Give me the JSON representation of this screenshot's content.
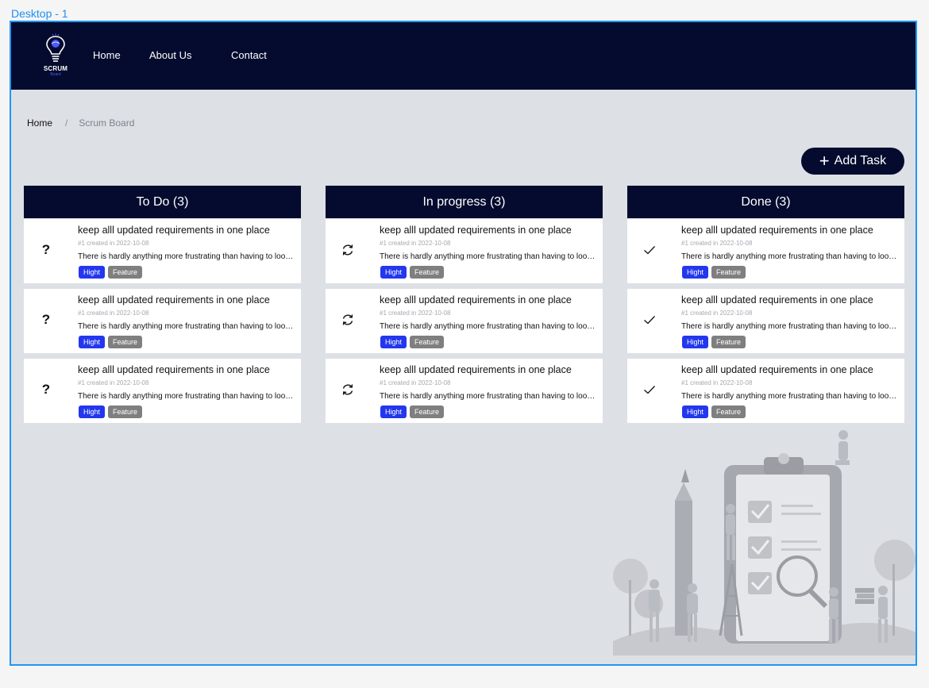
{
  "frame": {
    "label": "Desktop - 1"
  },
  "logo": {
    "text": "SCRUM",
    "subtext": "Board"
  },
  "nav": {
    "home": "Home",
    "about": "About Us",
    "contact": "Contact"
  },
  "breadcrumb": {
    "home": "Home",
    "separator": "/",
    "current": "Scrum Board"
  },
  "add_task": {
    "plus": "+",
    "label": "Add Task"
  },
  "columns": [
    {
      "title": "To Do (3)",
      "icon": "question-mark-icon",
      "cards": [
        {
          "title": "keep alll updated requirements in one place",
          "meta": "#1 created in 2022-10-08",
          "desc": "There is hardly anything more frustrating than having to look for current requirements in tens of comments",
          "priority": "Hight",
          "type": "Feature"
        },
        {
          "title": "keep alll updated requirements in one place",
          "meta": "#1 created in 2022-10-08",
          "desc": "There is hardly anything more frustrating than having to look for current requirements in tens of comments",
          "priority": "Hight",
          "type": "Feature"
        },
        {
          "title": "keep alll updated requirements in one place",
          "meta": "#1 created in 2022-10-08",
          "desc": "There is hardly anything more frustrating than having to look for current requirements in tens of comments",
          "priority": "Hight",
          "type": "Feature"
        }
      ]
    },
    {
      "title": "In progress (3)",
      "icon": "refresh-icon",
      "cards": [
        {
          "title": "keep alll updated requirements in one place",
          "meta": "#1 created in 2022-10-08",
          "desc": "There is hardly anything more frustrating than having to look for current requirements in tens of comments",
          "priority": "Hight",
          "type": "Feature"
        },
        {
          "title": "keep alll updated requirements in one place",
          "meta": "#1 created in 2022-10-08",
          "desc": "There is hardly anything more frustrating than having to look for current requirements in tens of comments",
          "priority": "Hight",
          "type": "Feature"
        },
        {
          "title": "keep alll updated requirements in one place",
          "meta": "#1 created in 2022-10-08",
          "desc": "There is hardly anything more frustrating than having to look for current requirements in tens of comments",
          "priority": "Hight",
          "type": "Feature"
        }
      ]
    },
    {
      "title": "Done (3)",
      "icon": "checkmark-icon",
      "cards": [
        {
          "title": "keep alll updated requirements in one place",
          "meta": "#1 created in 2022-10-08",
          "desc": "There is hardly anything more frustrating than having to look for current requirements in tens of comments",
          "priority": "Hight",
          "type": "Feature"
        },
        {
          "title": "keep alll updated requirements in one place",
          "meta": "#1 created in 2022-10-08",
          "desc": "There is hardly anything more frustrating than having to look for current requirements in tens of comments",
          "priority": "Hight",
          "type": "Feature"
        },
        {
          "title": "keep alll updated requirements in one place",
          "meta": "#1 created in 2022-10-08",
          "desc": "There is hardly anything more frustrating than having to look for current requirements in tens of comments",
          "priority": "Hight",
          "type": "Feature"
        }
      ]
    }
  ],
  "colors": {
    "navy": "#040b2e",
    "priority_tag": "#2337ee",
    "type_tag": "#7f7f7f",
    "background": "#dde0e5",
    "frame_border": "#2196f3"
  }
}
